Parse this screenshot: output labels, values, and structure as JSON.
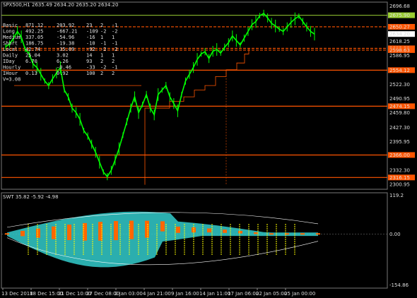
{
  "window": {
    "symbol_line": "SPX500,H1  2635.49 2634.20 2635.20 2634.20",
    "indicator_title": "SWT 35.82 -5.92 -4.98"
  },
  "stats_table": {
    "rows": [
      [
        "Basic",
        "871.12",
        "203.92",
        "23",
        "2",
        "-1"
      ],
      [
        "Long",
        "492.25",
        "-667.21",
        "-109",
        "-2",
        "-2"
      ],
      [
        "Medium",
        "337.05",
        "-54.96",
        "-16",
        "1",
        "1"
      ],
      [
        "Short",
        "186.75",
        "-19.38",
        "-10",
        "-1",
        "-1"
      ],
      [
        "Local",
        "42.74",
        "-35.09",
        "-92",
        "-2",
        "-2"
      ],
      [
        "Daily",
        "25.04",
        "3.02",
        "14",
        "1",
        "1"
      ],
      [
        "IDay",
        "6.70",
        "6.26",
        "93",
        "2",
        "2"
      ],
      [
        "Hourly",
        "",
        "-0.46",
        "-33",
        "-2",
        "-1"
      ],
      [
        "IHour",
        "0.13",
        "0.92",
        "100",
        "2",
        "2"
      ]
    ],
    "footer": "V=3.08"
  },
  "price_axis_labels": [
    "2696.68",
    "2675.90",
    "2634.20",
    "2618.25",
    "2586.95",
    "2554.40",
    "2522.30",
    "2490.95",
    "2459.80",
    "2427.30",
    "2395.95",
    "2364.00",
    "2332.30",
    "2300.95"
  ],
  "price_tags": [
    {
      "text": "2675.90",
      "value": 2675.9,
      "color": "#9acd32"
    },
    {
      "text": "2650.27",
      "value": 2650.27,
      "color": "#ff5500"
    },
    {
      "text": "2634.20",
      "value": 2634.2,
      "color": "#000000"
    },
    {
      "text": "2602.53",
      "value": 2602.53,
      "color": "#ff5500"
    },
    {
      "text": "2598.63",
      "value": 2598.63,
      "color": "#ff5500"
    },
    {
      "text": "2554.12",
      "value": 2554.12,
      "color": "#ff5500"
    },
    {
      "text": "2474.15",
      "value": 2474.15,
      "color": "#ff5500"
    },
    {
      "text": "2366.00",
      "value": 2366.0,
      "color": "#ff5500"
    },
    {
      "text": "2316.15",
      "value": 2316.15,
      "color": "#ff5500"
    }
  ],
  "indicator_axis": {
    "top": "119.2",
    "mid": "0.00",
    "bottom": "-154.86"
  },
  "time_labels": [
    "13 Dec 2018",
    "18 Dec 15:00",
    "21 Dec 10:00",
    "27 Dec 08:00",
    "2 Jan 03:00",
    "4 Jan 21:00",
    "9 Jan 16:00",
    "14 Jan 11:00",
    "17 Jan 06:00",
    "22 Jan 05:00",
    "25 Jan 00:00"
  ],
  "colors": {
    "bull": "#00ff00",
    "hline": "#ff5500",
    "stop": "#ff5500",
    "band_cyan": "#33cccc",
    "band_orange": "#ff6600",
    "yellow": "#ffff00",
    "grid": "#444444"
  },
  "chart_data": {
    "type": "line",
    "title": "SPX500,H1",
    "ylim": [
      2290,
      2705
    ],
    "x_ticks": [
      "13 Dec 2018",
      "18 Dec 15:00",
      "21 Dec 10:00",
      "27 Dec 08:00",
      "2 Jan 03:00",
      "4 Jan 21:00",
      "9 Jan 16:00",
      "14 Jan 11:00",
      "17 Jan 06:00",
      "22 Jan 05:00",
      "25 Jan 00:00"
    ],
    "price_path": [
      2606,
      2612,
      2625,
      2640,
      2628,
      2600,
      2590,
      2568,
      2560,
      2545,
      2530,
      2520,
      2535,
      2548,
      2560,
      2510,
      2495,
      2470,
      2460,
      2445,
      2420,
      2408,
      2390,
      2372,
      2350,
      2328,
      2318,
      2332,
      2355,
      2380,
      2410,
      2440,
      2470,
      2495,
      2460,
      2478,
      2500,
      2470,
      2455,
      2500,
      2510,
      2520,
      2495,
      2480,
      2464,
      2500,
      2530,
      2545,
      2560,
      2578,
      2590,
      2595,
      2580,
      2596,
      2600,
      2592,
      2605,
      2615,
      2630,
      2620,
      2610,
      2625,
      2640,
      2655,
      2662,
      2675,
      2680,
      2670,
      2658,
      2652,
      2645,
      2640,
      2650,
      2660,
      2668,
      2674,
      2662,
      2650,
      2640,
      2634
    ],
    "horizontal_levels": [
      2675.9,
      2650.27,
      2602.53,
      2598.63,
      2554.12,
      2474.15,
      2366.0,
      2316.15
    ],
    "indicator": {
      "ylim": [
        -154.86,
        119.2
      ],
      "zero": 0
    }
  }
}
